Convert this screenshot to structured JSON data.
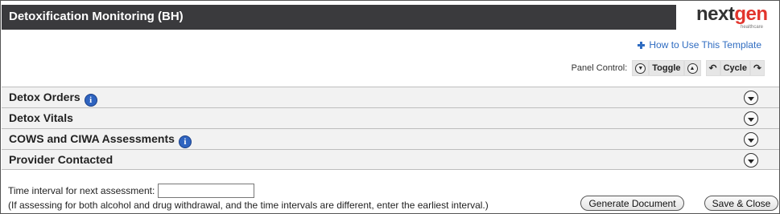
{
  "header": {
    "title": "Detoxification Monitoring (BH)"
  },
  "logo": {
    "word_part1": "next",
    "word_part2": "gen",
    "subtitle": "healthcare"
  },
  "howto": {
    "label": "How to Use This Template"
  },
  "panel_control": {
    "label": "Panel Control:",
    "toggle_label": "Toggle",
    "cycle_label": "Cycle"
  },
  "sections": [
    {
      "label": "Detox Orders",
      "has_info": true
    },
    {
      "label": "Detox Vitals",
      "has_info": false
    },
    {
      "label": "COWS and CIWA Assessments",
      "has_info": true
    },
    {
      "label": "Provider Contacted",
      "has_info": false
    }
  ],
  "interval": {
    "label": "Time interval for next assessment:",
    "value": "",
    "note": "(If assessing for both alcohol and drug withdrawal, and the time intervals are different, enter the earliest interval.)"
  },
  "buttons": {
    "generate": "Generate Document",
    "save_close": "Save & Close"
  },
  "icons": {
    "info_glyph": "i"
  }
}
